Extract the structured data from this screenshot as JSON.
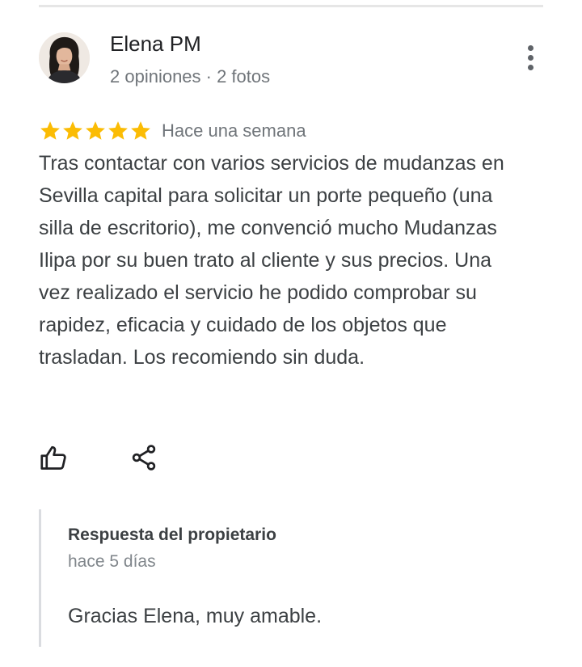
{
  "review": {
    "author": {
      "name": "Elena PM",
      "meta": "2 opiniones · 2 fotos",
      "avatar_icon": "user-photo"
    },
    "more_icon": "more-vert-icon",
    "rating": 5,
    "rating_max": 5,
    "star_color": "#fbbc04",
    "date": "Hace una semana",
    "text": "Tras contactar con varios servicios de mudanzas en Sevilla capital para solicitar un porte pequeño (una silla de escritorio), me convenció mucho Mudanzas Ilipa por su buen trato al cliente y sus precios. Una vez realizado el servicio he podido comprobar su rapidez, eficacia y cuidado de los objetos que trasladan. Los recomiendo sin duda.",
    "actions": {
      "like_icon": "thumb-up-icon",
      "share_icon": "share-icon"
    }
  },
  "owner_response": {
    "title": "Respuesta del propietario",
    "date": "hace 5 días",
    "text": "Gracias Elena, muy amable."
  }
}
